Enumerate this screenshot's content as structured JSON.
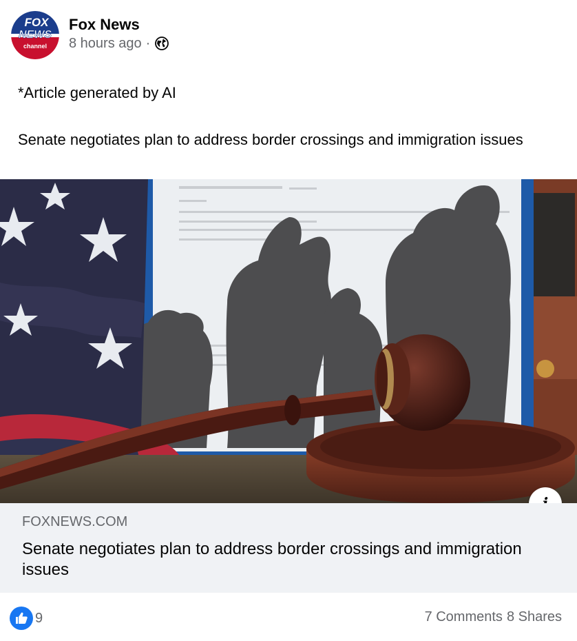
{
  "post": {
    "author": "Fox News",
    "timestamp": "8 hours ago",
    "separator": "·",
    "audience_icon": "globe-icon",
    "logo": {
      "line1": "FOX",
      "line2": "NEWS",
      "line3": "channel",
      "colors": {
        "blue": "#1b3d8c",
        "red": "#c8102e",
        "white": "#ffffff"
      }
    },
    "text_line1": "*Article generated by AI",
    "text_line2": "Senate negotiates plan to address border crossings and immigration issues"
  },
  "link_card": {
    "domain": "FOXNEWS.COM",
    "title": "Senate negotiates plan to address border crossings and immigration issues",
    "info_icon_label": "i"
  },
  "footer": {
    "like_count": "9",
    "comments": "7 Comments",
    "shares": "8 Shares"
  },
  "colors": {
    "accent": "#1877f2",
    "secondary_text": "#65676b",
    "card_bg": "#f0f2f5"
  }
}
